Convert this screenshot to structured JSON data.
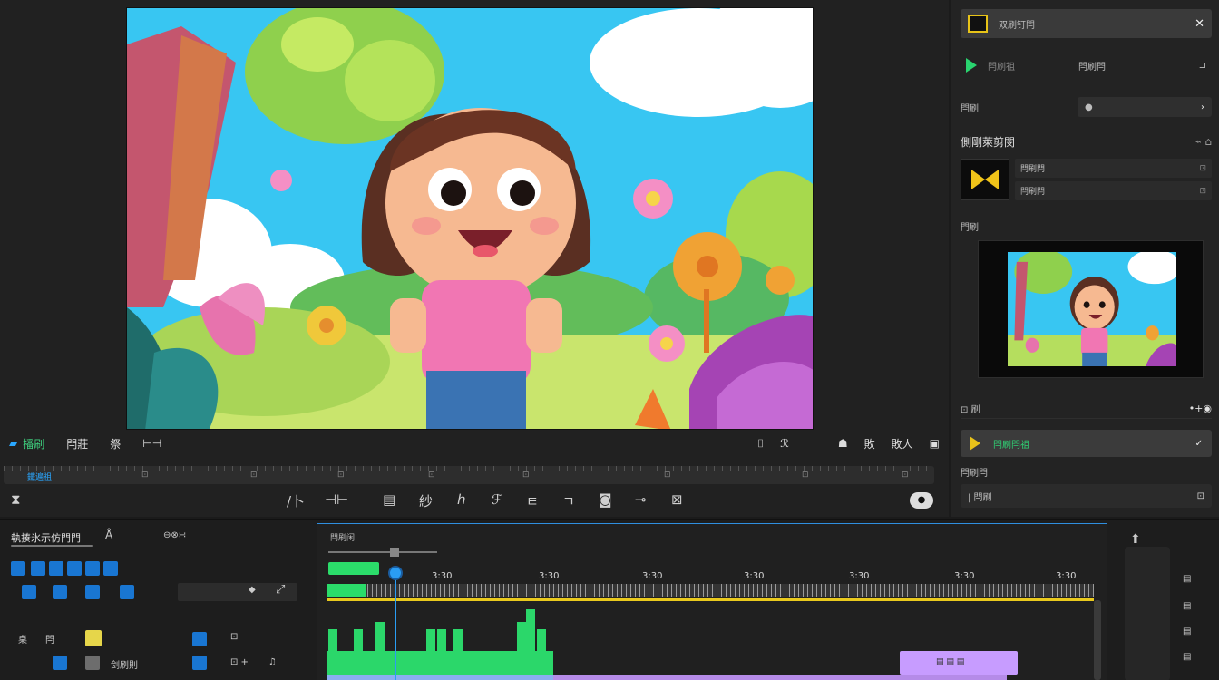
{
  "viewer": {
    "toolbar": {
      "tab_main": "播刷",
      "tab_2": "閂莊",
      "tab_3": "祭",
      "tab_4": "⊢⊣",
      "right_1": "⌷",
      "right_2": "ℛ",
      "right_3": "敗",
      "right_4": "敗人"
    },
    "scrub": {
      "start_label": "鐵遍祖",
      "marks": [
        "⊡",
        "⊡",
        "⊡",
        "⊡",
        "⊡",
        "⊡",
        "⊡",
        "⊡"
      ]
    },
    "tools": [
      "⧗",
      "/卜",
      "⊣⊢",
      "▤",
      "紗",
      "ℎ",
      "ℱ",
      "ㅌ",
      "ㄱ",
      "◙",
      "⊸",
      "⊠"
    ],
    "rec_label": "●"
  },
  "inspector": {
    "header_title": "双刷钉閂",
    "header_close": "✕",
    "play_label": "閂刷祖",
    "play_label_2": "閂刷閂",
    "dropdown_label": "閂刷",
    "dropdown_value": "●",
    "dropdown_chev": "›",
    "section_title": "側剛萊剪閔",
    "section_ctl": "⌁ ⌂",
    "clip_field_1": "閂刷閂",
    "clip_field_2": "閂刷閂",
    "clip_value_1": "⊡",
    "clip_value_2": "⊡",
    "preview_label": "閂刷",
    "time_label": "⊡ 刷",
    "time_value": "•+◉",
    "button_label": "閂刷閂祖",
    "button_icon": "✓",
    "sub_label": "閂刷閂",
    "field_label": "| 閂刷",
    "field_icon": "⊡"
  },
  "timeline_head": {
    "title": "執揍氷示仿閂閂",
    "title_icon": "Å",
    "sub": "⊖⊗∺",
    "row_labels": [
      "桌",
      "閂",
      "剑刷則"
    ],
    "row_values": [
      "⊡",
      "⊡ +",
      "♫"
    ]
  },
  "timeline": {
    "title": "閂刷闲",
    "ruler_labels": [
      "3:30",
      "3:30",
      "3:30",
      "3:30",
      "3:30",
      "3:30",
      "3:30"
    ],
    "clip_label": "▤ ▤ ▤"
  },
  "colors": {
    "accent_blue": "#2a9df4",
    "accent_green": "#2bd76a",
    "accent_yellow": "#e9c91d",
    "clip_purple": "#c79cff"
  }
}
